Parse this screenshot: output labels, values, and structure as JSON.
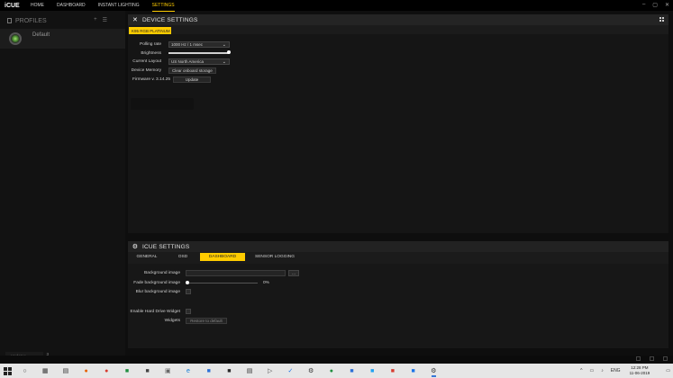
{
  "app": {
    "logo": "iCUE",
    "nav": [
      {
        "label": "HOME",
        "active": false
      },
      {
        "label": "DASHBOARD",
        "active": false
      },
      {
        "label": "INSTANT LIGHTING",
        "active": false
      },
      {
        "label": "SETTINGS",
        "active": true
      }
    ],
    "accent_color": "#ffcc00"
  },
  "profiles": {
    "title": "PROFILES",
    "items": [
      {
        "name": "Default"
      }
    ],
    "updates_label": "Updates",
    "updates_count": "3"
  },
  "device_settings": {
    "title": "DEVICE SETTINGS",
    "device_tab": "K95 RGB PLATINUM",
    "polling_rate": {
      "label": "Polling rate",
      "value": "1000 Hz / 1 msec"
    },
    "brightness": {
      "label": "Brightness",
      "level_percent": 100
    },
    "layout": {
      "label": "Current Layout",
      "value": "US North America"
    },
    "memory": {
      "label": "Device Memory",
      "button": "Clear onboard storage"
    },
    "firmware": {
      "label": "Firmware v. 3.14.25",
      "button": "Update"
    }
  },
  "icue_settings": {
    "title": "ICUE SETTINGS",
    "tabs": [
      {
        "label": "GENERAL",
        "active": false
      },
      {
        "label": "OSD",
        "active": false
      },
      {
        "label": "DASHBOARD",
        "active": true
      },
      {
        "label": "SENSOR LOGGING",
        "active": false
      }
    ],
    "background_image": {
      "label": "Background image",
      "browse": "..."
    },
    "fade_background": {
      "label": "Fade background image",
      "value_text": "0%",
      "level_percent": 0
    },
    "blur_background": {
      "label": "Blur background image"
    },
    "hard_drive_widget": {
      "label": "Enable Hard Drive Widget"
    },
    "widgets": {
      "label": "Widgets",
      "button": "Restore to default"
    }
  },
  "taskbar": {
    "language": "ENG",
    "time": "12:28 PM",
    "date": "11-06-2019"
  }
}
